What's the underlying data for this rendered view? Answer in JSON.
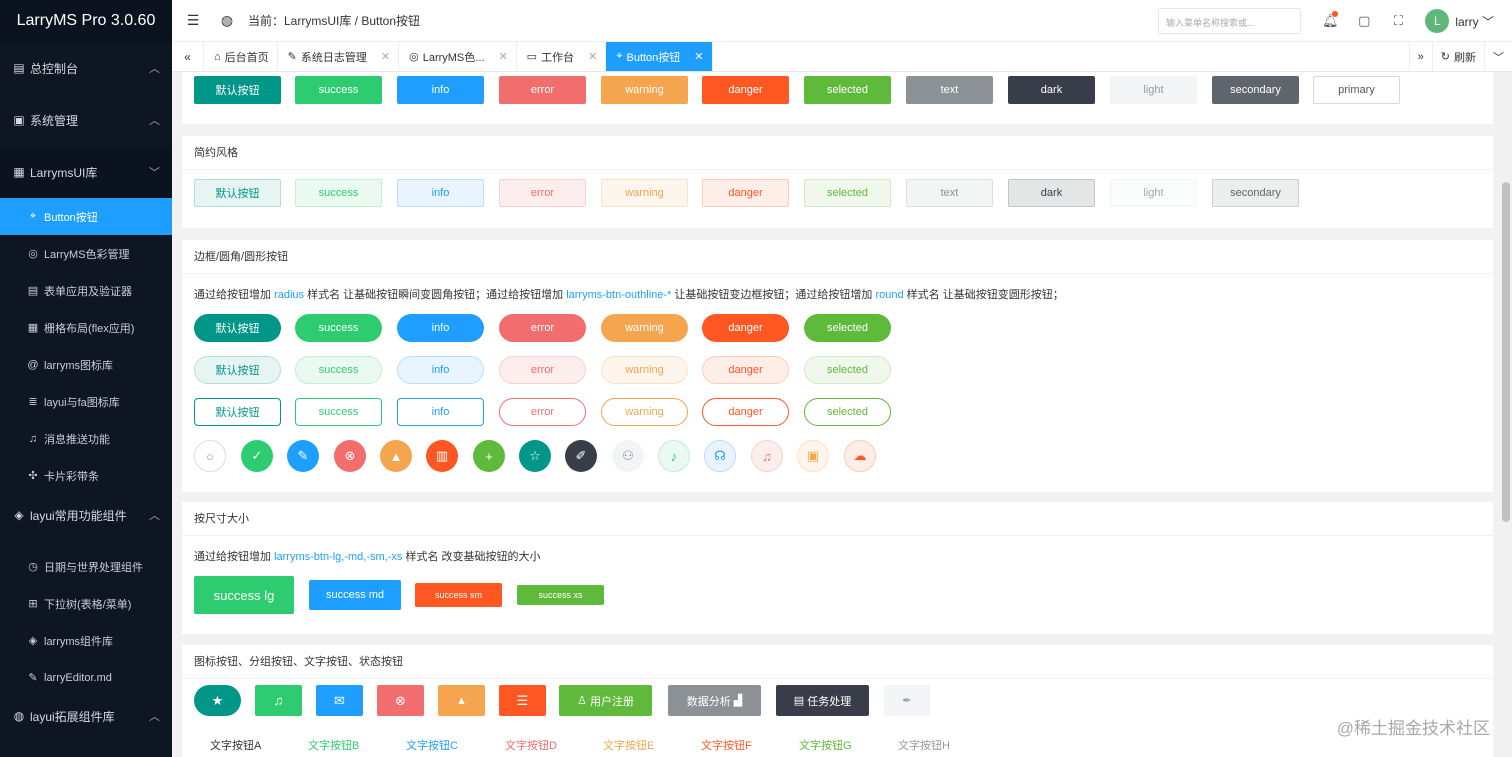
{
  "app": {
    "title": "LarryMS Pro 3.0.60"
  },
  "sidebar": {
    "groups": [
      {
        "label": "总控制台",
        "icon": "dashboard-icon"
      },
      {
        "label": "系统管理",
        "icon": "monitor-icon"
      },
      {
        "label": "LarrymsUI库",
        "icon": "grid-icon"
      }
    ],
    "items": [
      {
        "label": "Button按钮",
        "icon": "button-icon"
      },
      {
        "label": "LarryMS色彩管理",
        "icon": "palette-icon"
      },
      {
        "label": "表单应用及验证器",
        "icon": "form-icon"
      },
      {
        "label": "栅格布局(flex应用)",
        "icon": "layout-icon"
      },
      {
        "label": "larryms图标库",
        "icon": "at-icon"
      },
      {
        "label": "layui与fa图标库",
        "icon": "list-icon"
      },
      {
        "label": "消息推送功能",
        "icon": "bell-icon"
      },
      {
        "label": "卡片彩带条",
        "icon": "card-icon"
      }
    ],
    "group2": {
      "label": "layui常用功能组件",
      "icon": "layers-icon"
    },
    "items2": [
      {
        "label": "日期与世界处理组件",
        "icon": "clock-icon"
      },
      {
        "label": "下拉树(表格/菜单)",
        "icon": "tree-icon"
      },
      {
        "label": "larryms组件库",
        "icon": "layers-icon"
      },
      {
        "label": "larryEditor.md",
        "icon": "edit-icon"
      }
    ],
    "group3": {
      "label": "layui拓展组件库",
      "icon": "globe-icon"
    }
  },
  "header": {
    "breadcrumb": "当前：LarrymsUI库 / Button按钮",
    "search_placeholder": "输入菜单名称搜索或...",
    "user": "larry",
    "avatar": "L"
  },
  "tabs": [
    {
      "label": "后台首页",
      "icon": "home-icon",
      "closable": false
    },
    {
      "label": "系统日志管理",
      "icon": "log-icon",
      "closable": true
    },
    {
      "label": "LarryMS色...",
      "icon": "palette-icon",
      "closable": true
    },
    {
      "label": "工作台",
      "icon": "workbench-icon",
      "closable": true
    },
    {
      "label": "Button按钮",
      "icon": "button-icon",
      "closable": true
    }
  ],
  "tabs_right": {
    "refresh": "刷新"
  },
  "colors": {
    "default": "#009688",
    "success": "#2ecc71",
    "info": "#1e9fff",
    "error": "#f26d6d",
    "warning": "#f5a54d",
    "danger": "#ff5722",
    "selected": "#5fb93b",
    "text": "#8c9196",
    "dark": "#393d49",
    "light": "#f2f4f6",
    "secondary": "#60646c"
  },
  "buttons": [
    "默认按钮",
    "success",
    "info",
    "error",
    "warning",
    "danger",
    "selected",
    "text",
    "dark",
    "light",
    "secondary",
    "primary"
  ],
  "simple": {
    "title": "简约风格",
    "buttons": [
      "默认按钮",
      "success",
      "info",
      "error",
      "warning",
      "danger",
      "selected",
      "text",
      "dark",
      "light",
      "secondary"
    ]
  },
  "shapes": {
    "title": "边框/圆角/圆形按钮",
    "desc": [
      "通过给按钮增加 ",
      "radius",
      " 样式名 让基础按钮瞬间变圆角按钮；通过给按钮增加 ",
      "larryms-btn-outhline-*",
      " 让基础按钮变边框按钮；通过给按钮增加 ",
      "round",
      " 样式名 让基础按钮变圆形按钮；"
    ],
    "buttons": [
      "默认按钮",
      "success",
      "info",
      "error",
      "warning",
      "danger",
      "selected"
    ]
  },
  "sizes": {
    "title": "按尺寸大小",
    "desc": [
      "通过给按钮增加 ",
      "larryms-btn-lg,-md,-sm,-xs",
      " 样式名 改变基础按钮的大小"
    ],
    "buttons": [
      "success lg",
      "success md",
      "success sm",
      "success xs"
    ]
  },
  "icons": {
    "title": "图标按钮、分组按钮、文字按钮、状态按钮",
    "labeled": [
      "用户注册",
      "数据分析",
      "任务处理"
    ],
    "text_buttons": [
      "文字按钮A",
      "文字按钮B",
      "文字按钮C",
      "文字按钮D",
      "文字按钮E",
      "文字按钮F",
      "文字按钮G",
      "文字按钮H"
    ]
  },
  "watermark": "@稀土掘金技术社区"
}
